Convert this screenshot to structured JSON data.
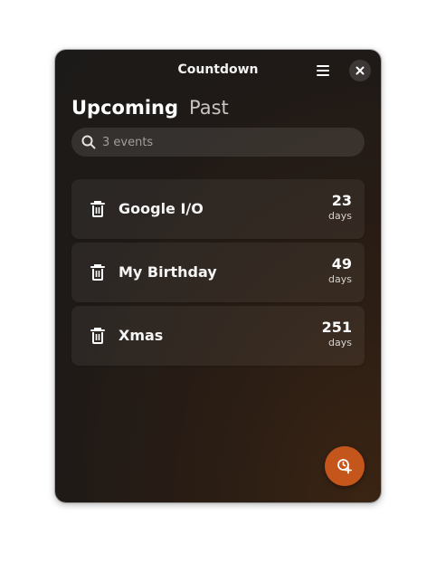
{
  "window": {
    "title": "Countdown"
  },
  "header": {
    "menu_icon": "hamburger-menu-icon",
    "close_icon": "close-icon"
  },
  "tabs": [
    {
      "label": "Upcoming",
      "active": true
    },
    {
      "label": "Past",
      "active": false
    }
  ],
  "search": {
    "placeholder": "3 events",
    "value": ""
  },
  "events": [
    {
      "name": "Google I/O",
      "count": "23",
      "unit": "days"
    },
    {
      "name": "My Birthday",
      "count": "49",
      "unit": "days"
    },
    {
      "name": "Xmas",
      "count": "251",
      "unit": "days"
    }
  ],
  "fab": {
    "icon": "add-alarm-icon"
  },
  "colors": {
    "accent": "#c4561b",
    "background": "#1f1a17",
    "row": "#2b2623"
  }
}
